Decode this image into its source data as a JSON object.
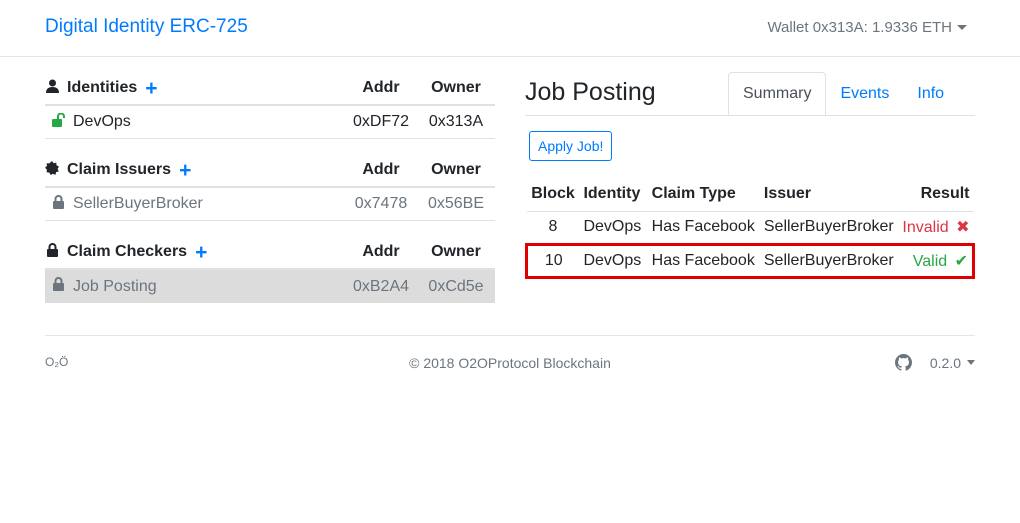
{
  "header": {
    "brand": "Digital Identity ERC-725",
    "wallet": "Wallet 0x313A: 1.9336 ETH"
  },
  "sections": [
    {
      "title": "Identities",
      "addr_header": "Addr",
      "owner_header": "Owner",
      "rows": [
        {
          "name": "DevOps",
          "addr": "0xDF72",
          "owner": "0x313A"
        }
      ]
    },
    {
      "title": "Claim Issuers",
      "addr_header": "Addr",
      "owner_header": "Owner",
      "rows": [
        {
          "name": "SellerBuyerBroker",
          "addr": "0x7478",
          "owner": "0x56BE"
        }
      ]
    },
    {
      "title": "Claim Checkers",
      "addr_header": "Addr",
      "owner_header": "Owner",
      "rows": [
        {
          "name": "Job Posting",
          "addr": "0xB2A4",
          "owner": "0xCd5e"
        }
      ]
    }
  ],
  "panel": {
    "title": "Job Posting",
    "tabs": [
      "Summary",
      "Events",
      "Info"
    ],
    "apply_button": "Apply Job!",
    "table": {
      "headers": [
        "Block",
        "Identity",
        "Claim Type",
        "Issuer",
        "Result"
      ],
      "rows": [
        {
          "block": "8",
          "identity": "DevOps",
          "claim_type": "Has Facebook",
          "issuer": "SellerBuyerBroker",
          "result": "Invalid"
        },
        {
          "block": "10",
          "identity": "DevOps",
          "claim_type": "Has Facebook",
          "issuer": "SellerBuyerBroker",
          "result": "Valid"
        }
      ]
    }
  },
  "footer": {
    "logo": "O₂Ö",
    "copyright": "© 2018  O2OProtocol Blockchain",
    "version": "0.2.0"
  },
  "colors": {
    "link": "#007bff",
    "invalid": "#dc3545",
    "valid": "#28a745",
    "highlight": "#e00000"
  }
}
